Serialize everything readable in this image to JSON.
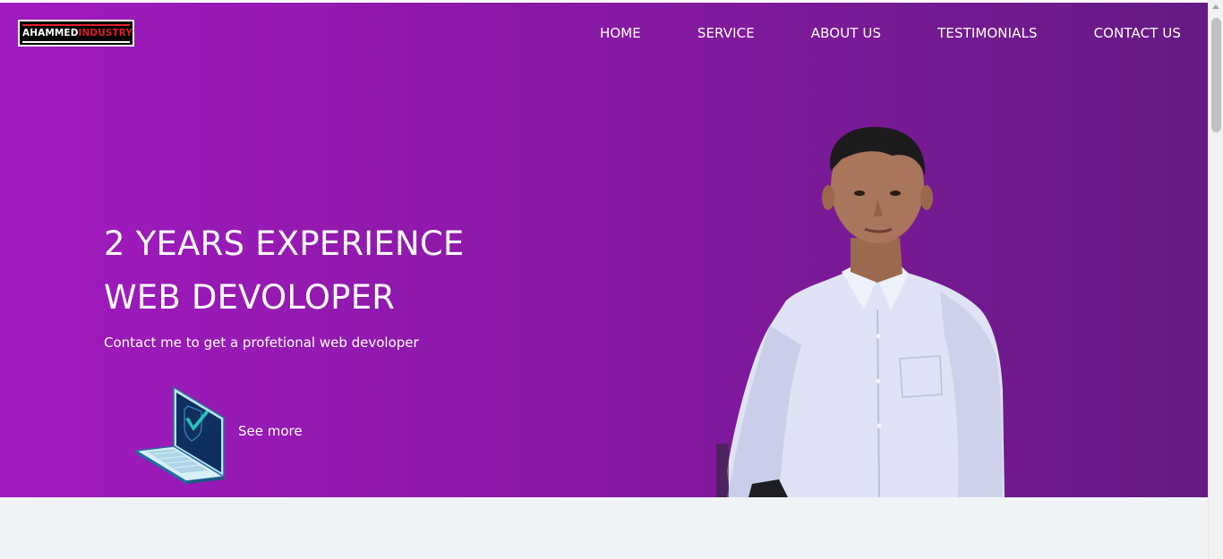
{
  "header": {
    "logo": {
      "text_primary": "AHAMMED",
      "text_accent": "INDUSTRY"
    },
    "nav": [
      {
        "label": "HOME"
      },
      {
        "label": "SERVICE"
      },
      {
        "label": "ABOUT US"
      },
      {
        "label": "TESTIMONIALS"
      },
      {
        "label": "CONTACT US"
      }
    ]
  },
  "hero": {
    "headline_line1": "2 YEARS EXPERIENCE",
    "headline_line2": "WEB DEVOLOPER",
    "subtext": "Contact me to get a profetional web devoloper",
    "cta_label": "See more",
    "cta_icon": "laptop-shield-check-icon",
    "portrait": "portrait-photo"
  },
  "colors": {
    "hero_gradient_start": "#a11abf",
    "hero_gradient_end": "#651a83",
    "below_bg": "#f0f3f6",
    "logo_accent": "#e01e2a"
  }
}
